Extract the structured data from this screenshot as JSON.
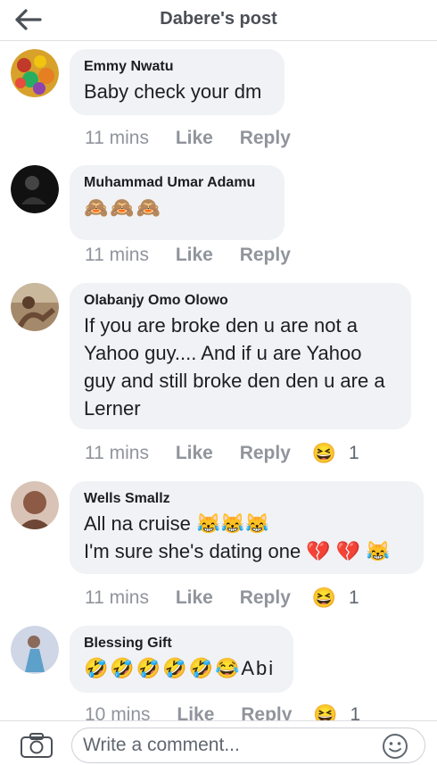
{
  "header": {
    "title": "Dabere's post"
  },
  "comments": [
    {
      "author": "Emmy Nwatu",
      "text": "Baby check your dm",
      "time": "11 mins",
      "like": "Like",
      "reply": "Reply"
    },
    {
      "author": "Muhammad Umar Adamu",
      "text": "🙈🙈🙈",
      "time": "11 mins",
      "like": "Like",
      "reply": "Reply"
    },
    {
      "author": "Olabanjy Omo Olowo",
      "text": "If you are broke den u are not a Yahoo guy.... And if u are Yahoo guy and still broke den den u are a Lerner",
      "time": "11 mins",
      "like": "Like",
      "reply": "Reply",
      "reaction": "😆",
      "reaction_count": "1"
    },
    {
      "author": "Wells Smallz",
      "text_line1": "All na cruise 😹😹😹",
      "text_line2": "I'm sure she's dating one 💔 💔 😹",
      "time": "11 mins",
      "like": "Like",
      "reply": "Reply",
      "reaction": "😆",
      "reaction_count": "1"
    },
    {
      "author": "Blessing Gift",
      "text": "🤣🤣🤣🤣🤣😂Abi",
      "time": "10 mins",
      "like": "Like",
      "reply": "Reply",
      "reaction": "😆",
      "reaction_count": "1"
    }
  ],
  "composer": {
    "placeholder": "Write a comment..."
  }
}
